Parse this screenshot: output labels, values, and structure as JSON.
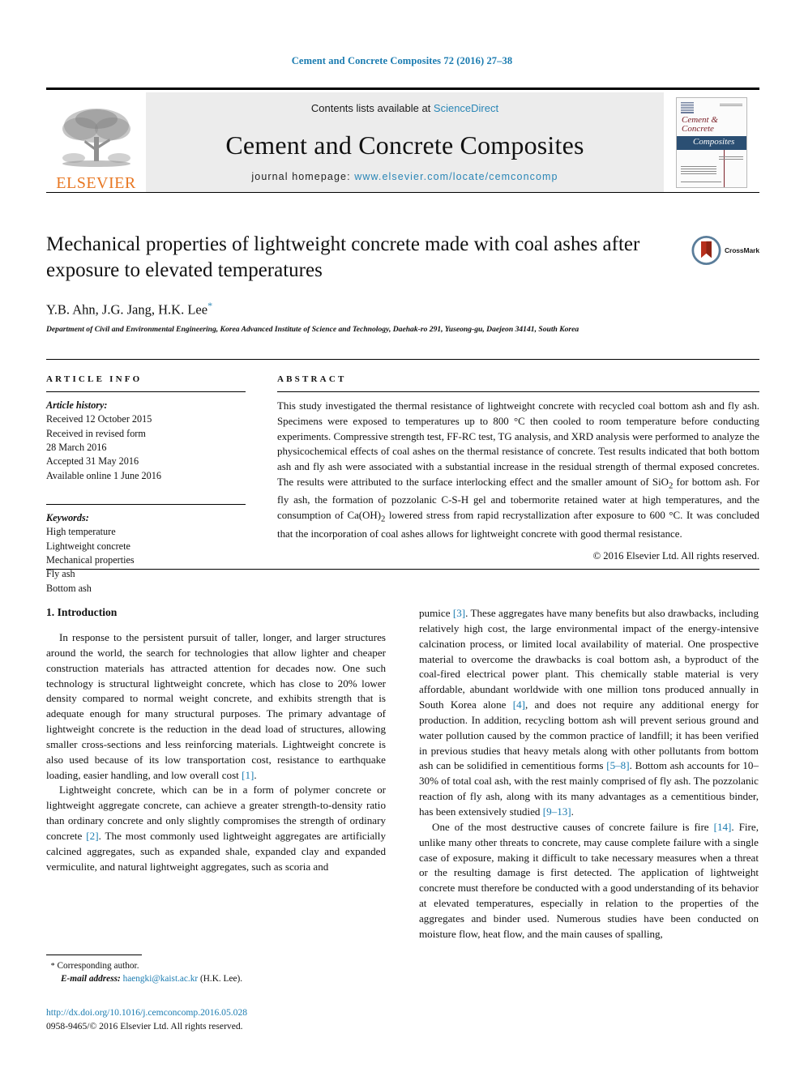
{
  "running_head": "Cement and Concrete Composites 72 (2016) 27–38",
  "masthead": {
    "contents_prefix": "Contents lists available at ",
    "sciencedirect": "ScienceDirect",
    "journal_title": "Cement and Concrete Composites",
    "homepage_prefix": "journal homepage: ",
    "homepage_url": "www.elsevier.com/locate/cemconcomp",
    "publisher": "ELSEVIER",
    "cover": {
      "line1": "Cement &",
      "line2": "Concrete",
      "line3": "Composites"
    },
    "accent_blue": "#2a86b6",
    "elsevier_orange": "#E87722",
    "cover_band": "#2b4f73",
    "cover_red": "#7c2129"
  },
  "title_block": {
    "title": "Mechanical properties of lightweight concrete made with coal ashes after exposure to elevated temperatures",
    "crossmark_label": "CrossMark",
    "authors": "Y.B. Ahn, J.G. Jang, H.K. Lee",
    "author_star": "*",
    "affiliation": "Department of Civil and Environmental Engineering, Korea Advanced Institute of Science and Technology, Daehak-ro 291, Yuseong-gu, Daejeon 34141, South Korea"
  },
  "article_info": {
    "heading": "ARTICLE INFO",
    "history_label": "Article history:",
    "history": [
      "Received 12 October 2015",
      "Received in revised form",
      "28 March 2016",
      "Accepted 31 May 2016",
      "Available online 1 June 2016"
    ],
    "keywords_label": "Keywords:",
    "keywords": [
      "High temperature",
      "Lightweight concrete",
      "Mechanical properties",
      "Fly ash",
      "Bottom ash"
    ]
  },
  "abstract": {
    "heading": "ABSTRACT",
    "text_parts": [
      "This study investigated the thermal resistance of lightweight concrete with recycled coal bottom ash and fly ash. Specimens were exposed to temperatures up to 800 °C then cooled to room temperature before conducting experiments. Compressive strength test, FF-RC test, TG analysis, and XRD analysis were performed to analyze the physicochemical effects of coal ashes on the thermal resistance of concrete. Test results indicated that both bottom ash and fly ash were associated with a substantial increase in the residual strength of thermal exposed concretes. The results were attributed to the surface interlocking effect and the smaller amount of SiO",
      "2",
      " for bottom ash. For fly ash, the formation of pozzolanic C-S-H gel and tobermorite retained water at high temperatures, and the consumption of Ca(OH)",
      "2",
      " lowered stress from rapid recrystallization after exposure to 600 °C. It was concluded that the incorporation of coal ashes allows for lightweight concrete with good thermal resistance."
    ],
    "copyright": "© 2016 Elsevier Ltd. All rights reserved."
  },
  "body": {
    "section_heading": "1. Introduction",
    "left_paragraphs": [
      {
        "segments": [
          {
            "t": "In response to the persistent pursuit of taller, longer, and larger structures around the world, the search for technologies that allow lighter and cheaper construction materials has attracted attention for decades now. One such technology is structural lightweight concrete, which has close to 20% lower density compared to normal weight concrete, and exhibits strength that is adequate enough for many structural purposes. The primary advantage of lightweight concrete is the reduction in the dead load of structures, allowing smaller cross-sections and less reinforcing materials. Lightweight concrete is also used because of its low transportation cost, resistance to earthquake loading, easier handling, and low overall cost "
          },
          {
            "t": "[1]",
            "ref": true
          },
          {
            "t": "."
          }
        ]
      },
      {
        "segments": [
          {
            "t": "Lightweight concrete, which can be in a form of polymer concrete or lightweight aggregate concrete, can achieve a greater strength-to-density ratio than ordinary concrete and only slightly compromises the strength of ordinary concrete "
          },
          {
            "t": "[2]",
            "ref": true
          },
          {
            "t": ". The most commonly used lightweight aggregates are artificially calcined aggregates, such as expanded shale, expanded clay and expanded vermiculite, and natural lightweight aggregates, such as scoria and"
          }
        ]
      }
    ],
    "right_paragraphs": [
      {
        "first": true,
        "segments": [
          {
            "t": "pumice "
          },
          {
            "t": "[3]",
            "ref": true
          },
          {
            "t": ". These aggregates have many benefits but also drawbacks, including relatively high cost, the large environmental impact of the energy-intensive calcination process, or limited local availability of material. One prospective material to overcome the drawbacks is coal bottom ash, a byproduct of the coal-fired electrical power plant. This chemically stable material is very affordable, abundant worldwide with one million tons produced annually in South Korea alone "
          },
          {
            "t": "[4]",
            "ref": true
          },
          {
            "t": ", and does not require any additional energy for production. In addition, recycling bottom ash will prevent serious ground and water pollution caused by the common practice of landfill; it has been verified in previous studies that heavy metals along with other pollutants from bottom ash can be solidified in cementitious forms "
          },
          {
            "t": "[5–8]",
            "ref": true
          },
          {
            "t": ". Bottom ash accounts for 10–30% of total coal ash, with the rest mainly comprised of fly ash. The pozzolanic reaction of fly ash, along with its many advantages as a cementitious binder, has been extensively studied "
          },
          {
            "t": "[9–13]",
            "ref": true
          },
          {
            "t": "."
          }
        ]
      },
      {
        "segments": [
          {
            "t": "One of the most destructive causes of concrete failure is fire "
          },
          {
            "t": "[14]",
            "ref": true
          },
          {
            "t": ". Fire, unlike many other threats to concrete, may cause complete failure with a single case of exposure, making it difficult to take necessary measures when a threat or the resulting damage is first detected. The application of lightweight concrete must therefore be conducted with a good understanding of its behavior at elevated temperatures, especially in relation to the properties of the aggregates and binder used. Numerous studies have been conducted on moisture flow, heat flow, and the main causes of spalling,"
          }
        ]
      }
    ]
  },
  "footer": {
    "corresponding_star": "*",
    "corresponding_label": "Corresponding author.",
    "email_label": "E-mail address:",
    "email": "haengki@kaist.ac.kr",
    "email_suffix": "(H.K. Lee).",
    "doi_url": "http://dx.doi.org/10.1016/j.cemconcomp.2016.05.028",
    "issn_line": "0958-9465/© 2016 Elsevier Ltd. All rights reserved."
  }
}
